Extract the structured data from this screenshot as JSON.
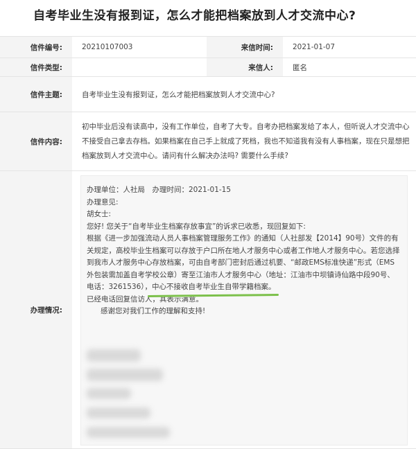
{
  "title": "自考毕业生没有报到证，怎么才能把档案放到人才交流中心?",
  "fields": {
    "letter_no_label": "信件编号:",
    "letter_no_value": "20210107003",
    "letter_date_label": "来信时间:",
    "letter_date_value": "2021-01-07",
    "letter_type_label": "信件类型:",
    "letter_type_value": "",
    "sender_label": "来信人:",
    "sender_value": "匿名",
    "subject_label": "信件主题:",
    "subject_value": "自考毕业生没有报到证，怎么才能把档案放到人才交流中心?",
    "content_label": "信件内容:",
    "content_value": "初中毕业后没有读高中，没有工作单位，自考了大专。自考办把档案发给了本人，但听说人才交流中心不接受自己拿去存档。如果档案在自己手上就成了死档，我也不知道我有没有人事档案，现在只是想把档案放到人才交流中心。请问有什么解决办法吗? 需要什么手续?",
    "reply_label": "办理情况:"
  },
  "reply": {
    "unit_line": "办理单位：人社局　办理时间：2021-01-15",
    "opinion_label": "办理意见:",
    "greeting": "胡女士:",
    "para1": "您好! 您关于“自考毕业生档案存放事宜”的诉求已收悉，现回复如下:",
    "para2_a": "根据《进一步加强流动人员人事档案管理服务工作》的通知（人社部发【2014】90号）文件的有关规定，高校毕业生档案可以存放于户口所在地人才服务中心或者工作地人才服务中心。若您选择到我市人才服务中心存放档案，可由自考部门密封后通过机要、“邮政EMS标准快递”形式（EMS外包装需加盖自考学校公章）寄至江油市人才服务中心（地址：江油市中坝镇诗仙路中段90号、电话：3261536），",
    "para2_highlight": "中心不接收自考毕业生自带学籍档案。",
    "para3": "已经电话回复信访人，其表示满意。",
    "para4": "感谢您对我们工作的理解和支持!"
  },
  "colors": {
    "highlight_underline": "#7cc04b",
    "label_bg": "#f4f4f4",
    "reply_bg": "#f7f7f7"
  }
}
